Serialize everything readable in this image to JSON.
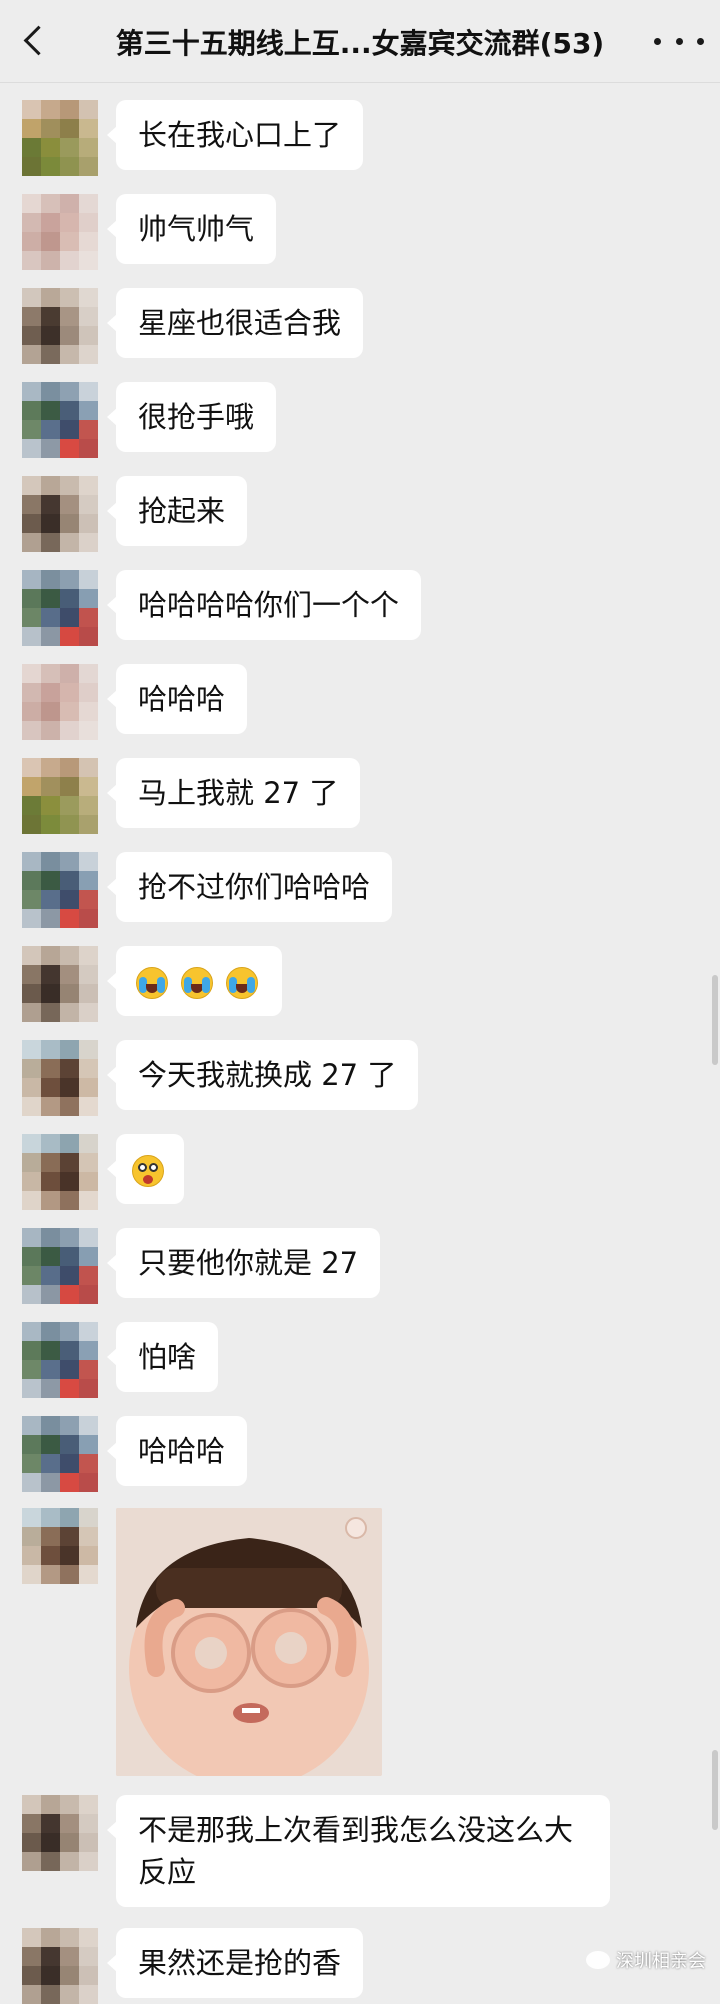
{
  "header": {
    "title": "第三十五期线上互...女嘉宾交流群(53)"
  },
  "messages": [
    {
      "text": "长在我心口上了",
      "avatar": [
        "#d9c4b2",
        "#c6a98c",
        "#b79878",
        "#d3c2b1",
        "#c0a36a",
        "#a08f5c",
        "#8d7f4a",
        "#c9b88f",
        "#6b7a36",
        "#8a8e3c",
        "#9a9a5c",
        "#b7ac7a",
        "#6c7435",
        "#7b8a3a",
        "#8f9350",
        "#a8a06c"
      ]
    },
    {
      "text": "帅气帅气",
      "avatar": [
        "#e5d7d2",
        "#d7c0b9",
        "#cfb1ab",
        "#e4d8d4",
        "#d3b9b2",
        "#c9a39c",
        "#d6b6ae",
        "#e0cfca",
        "#cdaea6",
        "#bf978e",
        "#d9bdb4",
        "#e6d9d4",
        "#d9c6c0",
        "#cdb3ab",
        "#e2d3cf",
        "#e9e0dc"
      ]
    },
    {
      "text": "星座也很适合我",
      "avatar": [
        "#d2c7bd",
        "#b9a898",
        "#ccbfb2",
        "#e0d8d1",
        "#8d7a6a",
        "#4a3b31",
        "#a89585",
        "#d8cfc7",
        "#6f5e50",
        "#3d3029",
        "#9c8a7b",
        "#cfc4ba",
        "#b3a394",
        "#7a6a5c",
        "#c6b8ab",
        "#ddd4cc"
      ]
    },
    {
      "text": "很抢手哦",
      "avatar": [
        "#a9b8c4",
        "#7a8f9f",
        "#8ea1b2",
        "#c9d2da",
        "#5d7a5a",
        "#3c5b44",
        "#4a5e78",
        "#8aa0b4",
        "#6e8868",
        "#5a6f8c",
        "#3f4d6b",
        "#c2554f",
        "#b9c3cc",
        "#8d99a6",
        "#d84a42",
        "#b94c4a"
      ]
    },
    {
      "text": "抢起来",
      "avatar": [
        "#d4c7bb",
        "#b8a797",
        "#c9bbae",
        "#ded4cb",
        "#8a7766",
        "#453730",
        "#a49080",
        "#d5cbc2",
        "#6c5b4d",
        "#3a2e28",
        "#978574",
        "#ccc0b6",
        "#b0a091",
        "#78685a",
        "#c3b5a8",
        "#dbd1c9"
      ]
    },
    {
      "text": "哈哈哈哈你们一个个",
      "avatar": [
        "#a6b5c2",
        "#7b8f9e",
        "#8c9fb0",
        "#c7d0d8",
        "#5b785a",
        "#3b5a43",
        "#485d77",
        "#879eb2",
        "#6c8666",
        "#586d8a",
        "#3e4c6a",
        "#c1534e",
        "#b7c1ca",
        "#8b97a4",
        "#d64941",
        "#b84b49"
      ]
    },
    {
      "text": "哈哈哈",
      "avatar": [
        "#e4d6d1",
        "#d6bfb8",
        "#ceb0aa",
        "#e3d7d3",
        "#d2b8b1",
        "#c8a29b",
        "#d5b5ad",
        "#dfcec9",
        "#ccada5",
        "#be968d",
        "#d8bcb3",
        "#e5d8d3",
        "#d8c5bf",
        "#ccb2aa",
        "#e1d2ce",
        "#e8dfdb"
      ]
    },
    {
      "text": "马上我就 27 了",
      "avatar": [
        "#dac5b3",
        "#c7aa8d",
        "#b89979",
        "#d4c3b2",
        "#c1a46b",
        "#a1905d",
        "#8e804b",
        "#cab990",
        "#6c7b37",
        "#8b8f3d",
        "#9b9b5d",
        "#b8ad7b",
        "#6d7536",
        "#7c8b3b",
        "#909451",
        "#a9a16d"
      ]
    },
    {
      "text": "抢不过你们哈哈哈",
      "avatar": [
        "#a8b7c3",
        "#798e9e",
        "#8da0b1",
        "#c8d1d9",
        "#5c795b",
        "#3b5a43",
        "#495d77",
        "#889fb3",
        "#6d8767",
        "#596e8b",
        "#3f4d6b",
        "#c2554f",
        "#b8c2cb",
        "#8c98a5",
        "#d74a42",
        "#b94c4a"
      ]
    },
    {
      "emoji": [
        "cry",
        "cry",
        "cry"
      ],
      "avatar": [
        "#d3c6ba",
        "#b7a696",
        "#c8baad",
        "#ddd3ca",
        "#897665",
        "#44362f",
        "#a38f7f",
        "#d4cac1",
        "#6b5a4c",
        "#392d27",
        "#968473",
        "#cbbfb5",
        "#af9f90",
        "#776759",
        "#c2b4a7",
        "#dad0c8"
      ]
    },
    {
      "text": "今天我就换成 27 了",
      "avatar": [
        "#c9d6dc",
        "#a9bcc6",
        "#8ea5b0",
        "#d8d4cc",
        "#b9ad9a",
        "#8a6d57",
        "#5c4335",
        "#d5c6b6",
        "#c9b8a6",
        "#6e4f3d",
        "#4a3429",
        "#cdb9a5",
        "#e0d5ca",
        "#b39984",
        "#8f725e",
        "#e4d9cf"
      ]
    },
    {
      "emoji": [
        "shock"
      ],
      "avatar": [
        "#c8d5db",
        "#a8bbc5",
        "#8da4af",
        "#d7d3cb",
        "#b8ac99",
        "#896c56",
        "#5b4234",
        "#d4c5b5",
        "#c8b7a5",
        "#6d4e3c",
        "#493328",
        "#ccb8a4",
        "#dfd4c9",
        "#b29883",
        "#8e715d",
        "#e3d8ce"
      ]
    },
    {
      "text": "只要他你就是 27",
      "avatar": [
        "#a7b6c2",
        "#7a8e9e",
        "#8c9fb0",
        "#c7d0d8",
        "#5b785a",
        "#3b5a43",
        "#485d77",
        "#879eb2",
        "#6c8666",
        "#586d8a",
        "#3e4c6a",
        "#c1534e",
        "#b7c1ca",
        "#8b97a4",
        "#d64941",
        "#b84b49"
      ]
    },
    {
      "text": "怕啥",
      "avatar": [
        "#a9b8c4",
        "#7a8f9f",
        "#8ea1b2",
        "#c9d2da",
        "#5d7a5a",
        "#3c5b44",
        "#4a5e78",
        "#8aa0b4",
        "#6e8868",
        "#5a6f8c",
        "#3f4d6b",
        "#c2554f",
        "#b9c3cc",
        "#8d99a6",
        "#d84a42",
        "#b94c4a"
      ]
    },
    {
      "text": "哈哈哈",
      "avatar": [
        "#a8b7c3",
        "#798e9e",
        "#8da0b1",
        "#c8d1d9",
        "#5c795b",
        "#3b5a43",
        "#495d77",
        "#889fb3",
        "#6d8767",
        "#596e8b",
        "#3f4d6b",
        "#c2554f",
        "#b8c2cb",
        "#8c98a5",
        "#d74a42",
        "#b94c4a"
      ]
    },
    {
      "sticker": "baby-covering-eyes",
      "avatar": [
        "#c9d6dc",
        "#a9bcc6",
        "#8ea5b0",
        "#d8d4cc",
        "#b9ad9a",
        "#8a6d57",
        "#5c4335",
        "#d5c6b6",
        "#c9b8a6",
        "#6e4f3d",
        "#4a3429",
        "#cdb9a5",
        "#e0d5ca",
        "#b39984",
        "#8f725e",
        "#e4d9cf"
      ]
    },
    {
      "text": "不是那我上次看到我怎么没这么大反应",
      "avatar": [
        "#d3c6ba",
        "#b7a696",
        "#c8baad",
        "#ddd3ca",
        "#897665",
        "#44362f",
        "#a38f7f",
        "#d4cac1",
        "#6b5a4c",
        "#392d27",
        "#968473",
        "#cbbfb5",
        "#af9f90",
        "#776759",
        "#c2b4a7",
        "#dad0c8"
      ]
    },
    {
      "text": "果然还是抢的香",
      "avatar": [
        "#d4c7bb",
        "#b8a797",
        "#c9bbae",
        "#ded4cb",
        "#8a7766",
        "#453730",
        "#a49080",
        "#d5cbc2",
        "#6c5b4d",
        "#3a2e28",
        "#978574",
        "#ccc0b6",
        "#b0a091",
        "#78685a",
        "#c3b5a8",
        "#dbd1c9"
      ]
    }
  ],
  "watermark": {
    "text": "深圳相亲会"
  }
}
